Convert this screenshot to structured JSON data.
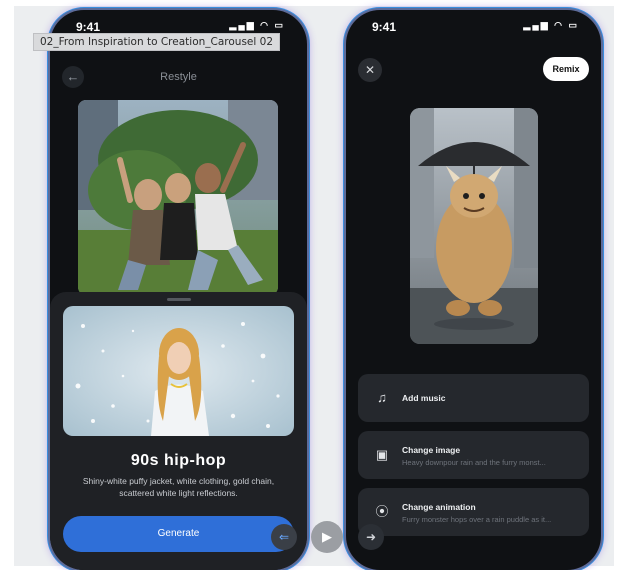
{
  "caption": "02_From Inspiration to Creation_Carousel 02",
  "left_phone": {
    "status_time": "9:41",
    "nav_title": "Restyle",
    "style_title": "90s hip-hop",
    "style_description": "Shiny-white puffy jacket, white clothing, gold chain, scattered white light reflections.",
    "generate_label": "Generate"
  },
  "right_phone": {
    "status_time": "9:41",
    "remix_label": "Remix",
    "actions": [
      {
        "title": "Add music",
        "subtitle": "",
        "icon": "music-note-icon"
      },
      {
        "title": "Change image",
        "subtitle": "Heavy downpour rain and the furry monst...",
        "icon": "image-edit-icon"
      },
      {
        "title": "Change animation",
        "subtitle": "Furry monster hops over a rain puddle as it...",
        "icon": "play-circle-icon"
      }
    ]
  },
  "controls": {
    "back_icon": "arrow-left-icon",
    "play_icon": "play-icon",
    "next_icon": "arrow-right-icon"
  }
}
